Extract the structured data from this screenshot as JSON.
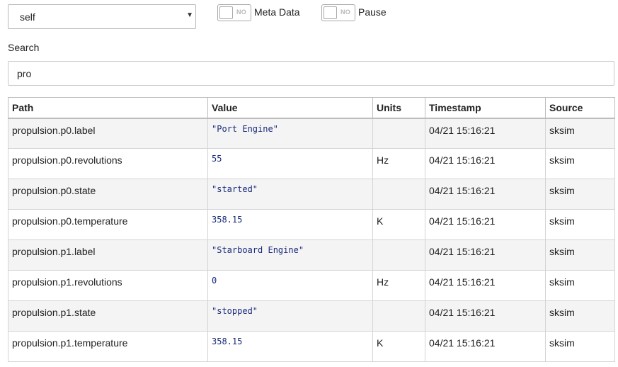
{
  "context_select": {
    "value": "self"
  },
  "toggles": {
    "meta_data": {
      "state": "NO",
      "label": "Meta Data"
    },
    "pause": {
      "state": "NO",
      "label": "Pause"
    }
  },
  "search": {
    "label": "Search",
    "value": "pro"
  },
  "table": {
    "headers": [
      "Path",
      "Value",
      "Units",
      "Timestamp",
      "Source"
    ],
    "rows": [
      {
        "path": "propulsion.p0.label",
        "value": "\"Port Engine\"",
        "units": "",
        "timestamp": "04/21 15:16:21",
        "source": "sksim"
      },
      {
        "path": "propulsion.p0.revolutions",
        "value": "55",
        "units": "Hz",
        "timestamp": "04/21 15:16:21",
        "source": "sksim"
      },
      {
        "path": "propulsion.p0.state",
        "value": "\"started\"",
        "units": "",
        "timestamp": "04/21 15:16:21",
        "source": "sksim"
      },
      {
        "path": "propulsion.p0.temperature",
        "value": "358.15",
        "units": "K",
        "timestamp": "04/21 15:16:21",
        "source": "sksim"
      },
      {
        "path": "propulsion.p1.label",
        "value": "\"Starboard Engine\"",
        "units": "",
        "timestamp": "04/21 15:16:21",
        "source": "sksim"
      },
      {
        "path": "propulsion.p1.revolutions",
        "value": "0",
        "units": "Hz",
        "timestamp": "04/21 15:16:21",
        "source": "sksim"
      },
      {
        "path": "propulsion.p1.state",
        "value": "\"stopped\"",
        "units": "",
        "timestamp": "04/21 15:16:21",
        "source": "sksim"
      },
      {
        "path": "propulsion.p1.temperature",
        "value": "358.15",
        "units": "K",
        "timestamp": "04/21 15:16:21",
        "source": "sksim"
      }
    ]
  }
}
